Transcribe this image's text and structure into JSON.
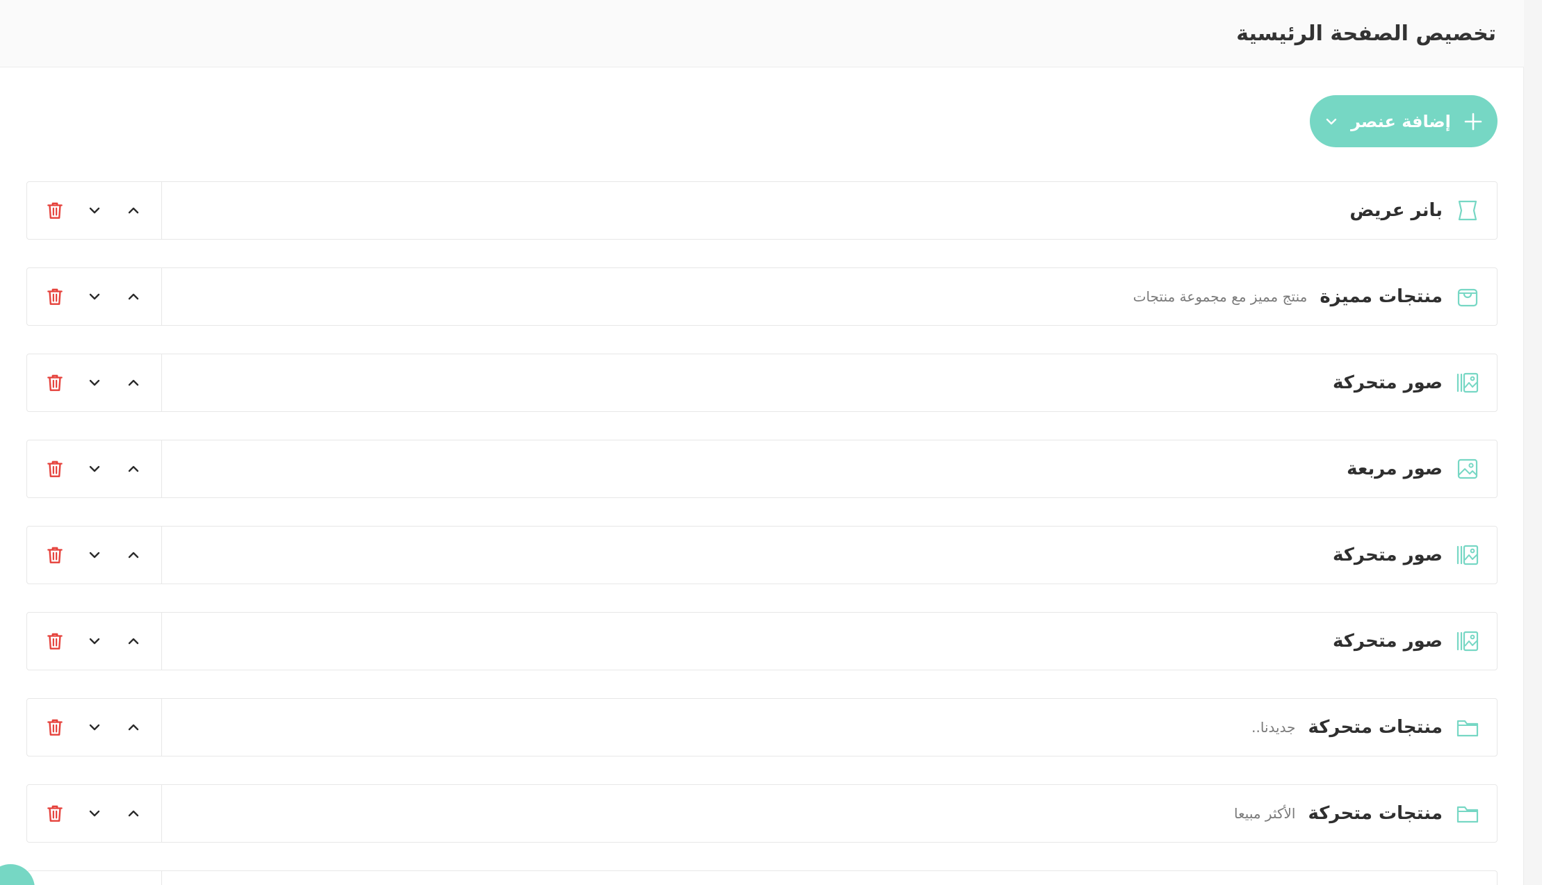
{
  "header": {
    "title": "تخصيص الصفحة الرئيسية"
  },
  "toolbar": {
    "add_label": "إضافة عنصر"
  },
  "sections": [
    {
      "title": "بانر عريض",
      "subtitle": "",
      "icon": "banner-icon"
    },
    {
      "title": "منتجات مميزة",
      "subtitle": "منتج مميز مع مجموعة منتجات",
      "icon": "shopping-bag-icon"
    },
    {
      "title": "صور متحركة",
      "subtitle": "",
      "icon": "image-slider-icon"
    },
    {
      "title": "صور مربعة",
      "subtitle": "",
      "icon": "square-image-icon"
    },
    {
      "title": "صور متحركة",
      "subtitle": "",
      "icon": "image-slider-icon"
    },
    {
      "title": "صور متحركة",
      "subtitle": "",
      "icon": "image-slider-icon"
    },
    {
      "title": "منتجات متحركة",
      "subtitle": "جديدنا..",
      "icon": "folder-icon"
    },
    {
      "title": "منتجات متحركة",
      "subtitle": "الأكثر مبيعا",
      "icon": "folder-icon"
    }
  ],
  "colors": {
    "accent": "#76D7C4",
    "danger": "#E5403A"
  }
}
